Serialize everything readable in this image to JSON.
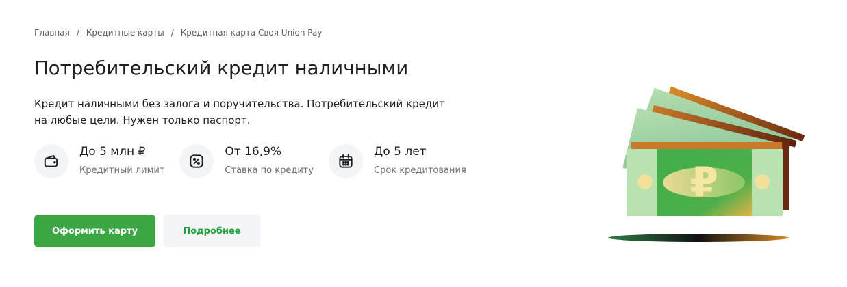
{
  "breadcrumb": {
    "items": [
      "Главная",
      "Кредитные карты",
      "Кредитная карта Своя Union Pay"
    ],
    "separator": "/"
  },
  "hero": {
    "title": "Потребительский кредит наличными",
    "description": "Кредит наличными без залога и поручительства. Потребительский кредит на любые цели. Нужен только паспорт."
  },
  "features": [
    {
      "icon": "wallet-icon",
      "value": "До 5 млн ₽",
      "label": "Кредитный лимит"
    },
    {
      "icon": "percent-icon",
      "value": "От 16,9%",
      "label": "Ставка по кредиту"
    },
    {
      "icon": "calendar-icon",
      "value": "До 5 лет",
      "label": "Срок кредитования"
    }
  ],
  "buttons": {
    "primary": "Оформить карту",
    "secondary": "Подробнее"
  },
  "illustration": {
    "icon": "ruble-banknotes-icon",
    "symbol": "₽"
  },
  "colors": {
    "accent": "#3ca544",
    "accent_text": "#21a038",
    "light_bg": "#f2f4f7"
  }
}
